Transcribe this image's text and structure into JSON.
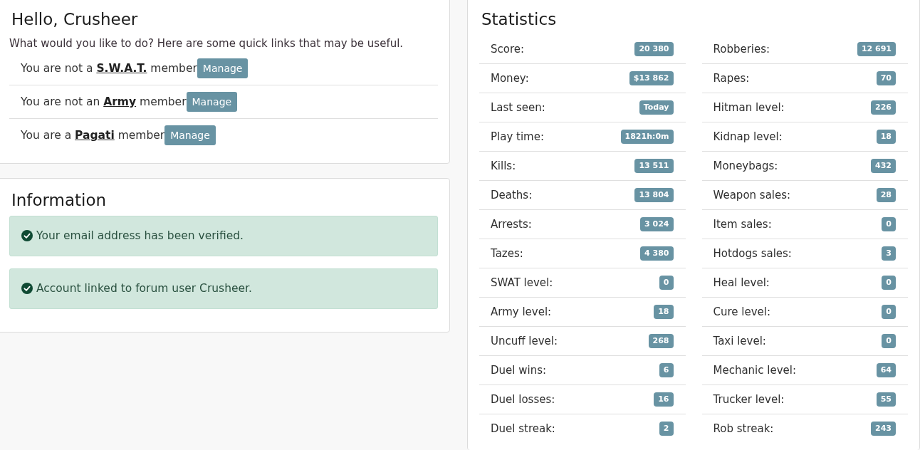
{
  "greeting_card": {
    "title": "Hello, Crusheer",
    "intro": "What would you like to do? Here are some quick links that may be useful.",
    "memberships": [
      {
        "prefix": "You are not a",
        "group": "S.W.A.T.",
        "suffix": "member",
        "button": "Manage"
      },
      {
        "prefix": "You are not an",
        "group": "Army",
        "suffix": "member",
        "button": "Manage"
      },
      {
        "prefix": "You are a",
        "group": "Pagati",
        "suffix": "member",
        "button": "Manage"
      }
    ]
  },
  "information_card": {
    "title": "Information",
    "alerts": [
      {
        "kind": "success",
        "text": "Your email address has been verified."
      },
      {
        "kind": "success",
        "text": "Account linked to forum user Crusheer."
      }
    ]
  },
  "statistics_card": {
    "title": "Statistics",
    "columns": [
      {
        "rows": [
          {
            "label": "Score:",
            "value": "20 380"
          },
          {
            "label": "Money:",
            "value": "$13 862"
          },
          {
            "label": "Last seen:",
            "value": "Today"
          },
          {
            "label": "Play time:",
            "value": "1821h:0m"
          },
          {
            "label": "Kills:",
            "value": "13 511"
          },
          {
            "label": "Deaths:",
            "value": "13 804"
          },
          {
            "label": "Arrests:",
            "value": "3 024"
          },
          {
            "label": "Tazes:",
            "value": "4 380"
          },
          {
            "label": "SWAT level:",
            "value": "0"
          },
          {
            "label": "Army level:",
            "value": "18"
          },
          {
            "label": "Uncuff level:",
            "value": "268"
          },
          {
            "label": "Duel wins:",
            "value": "6"
          },
          {
            "label": "Duel losses:",
            "value": "16"
          },
          {
            "label": "Duel streak:",
            "value": "2"
          }
        ]
      },
      {
        "rows": [
          {
            "label": "Robberies:",
            "value": "12 691"
          },
          {
            "label": "Rapes:",
            "value": "70"
          },
          {
            "label": "Hitman level:",
            "value": "226"
          },
          {
            "label": "Kidnap level:",
            "value": "18"
          },
          {
            "label": "Moneybags:",
            "value": "432"
          },
          {
            "label": "Weapon sales:",
            "value": "28"
          },
          {
            "label": "Item sales:",
            "value": "0"
          },
          {
            "label": "Hotdogs sales:",
            "value": "3"
          },
          {
            "label": "Heal level:",
            "value": "0"
          },
          {
            "label": "Cure level:",
            "value": "0"
          },
          {
            "label": "Taxi level:",
            "value": "0"
          },
          {
            "label": "Mechanic level:",
            "value": "64"
          },
          {
            "label": "Trucker level:",
            "value": "55"
          },
          {
            "label": "Rob streak:",
            "value": "243"
          }
        ]
      }
    ]
  }
}
